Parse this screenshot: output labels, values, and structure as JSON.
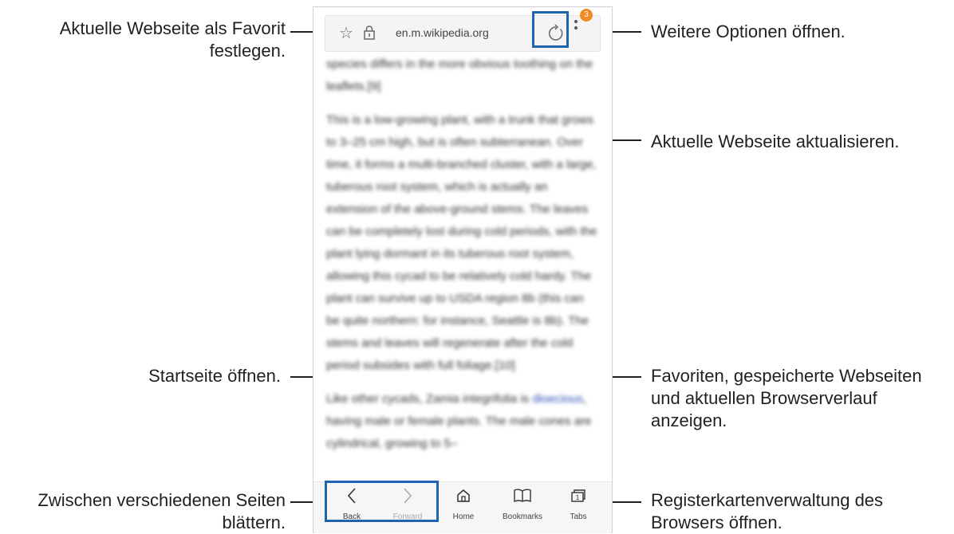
{
  "callouts": {
    "favorite": [
      "Aktuelle Webseite als Favorit",
      "festlegen."
    ],
    "more_options": "Weitere Optionen öffnen.",
    "refresh": "Aktuelle Webseite aktualisieren.",
    "home": "Startseite öffnen.",
    "bookmarks": [
      "Favoriten, gespeicherte Webseiten",
      "und aktuellen Browserverlauf",
      "anzeigen."
    ],
    "navigate": [
      "Zwischen verschiedenen Seiten",
      "blättern."
    ],
    "tabs": [
      "Registerkartenverwaltung des",
      "Browsers öffnen."
    ]
  },
  "browser": {
    "url": "en.m.wikipedia.org",
    "badge_count": "3",
    "content": {
      "p1": "species differs in the more obvious toothing on the leaflets.[9]",
      "p2": "This is a low-growing plant, with a trunk that grows to 3–25 cm high, but is often subterranean. Over time, it forms a multi-branched cluster, with a large, tuberous root system, which is actually an extension of the above-ground stems. The leaves can be completely lost during cold periods, with the plant lying dormant in its tuberous root system, allowing this cycad to be relatively cold hardy. The plant can survive up to USDA region 8b (this can be quite northern: for instance, Seattle is 8b). The stems and leaves will regenerate after the cold period subsides with full foliage.[10]",
      "p3_before": "Like other cycads, Zamia integrifolia is ",
      "p3_link": "dioecious",
      "p3_after": ", having male or female plants. The male cones are cylindrical, growing to 5–"
    },
    "nav": {
      "back": "Back",
      "forward": "Forward",
      "home": "Home",
      "bookmarks": "Bookmarks",
      "tabs": "Tabs"
    }
  },
  "colors": {
    "highlight": "#1f63b3",
    "badge": "#f08a24",
    "link": "#2f4fb5"
  },
  "icons": [
    "star-icon",
    "lock-icon",
    "refresh-icon",
    "more-options-icon",
    "back-icon",
    "forward-icon",
    "home-icon",
    "bookmarks-icon",
    "tabs-icon"
  ]
}
